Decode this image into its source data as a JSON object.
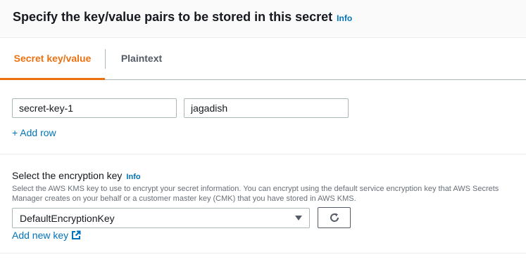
{
  "header": {
    "title": "Specify the key/value pairs to be stored in this secret",
    "info_label": "Info"
  },
  "tabs": [
    {
      "label": "Secret key/value",
      "active": true
    },
    {
      "label": "Plaintext",
      "active": false
    }
  ],
  "key_value": {
    "rows": [
      {
        "key": "secret-key-1",
        "value": "jagadish"
      }
    ],
    "add_row_label": "+ Add row"
  },
  "encryption": {
    "label": "Select the encryption key",
    "info_label": "Info",
    "description": "Select the AWS KMS key to use to encrypt your secret information. You can encrypt using the default service encryption key that AWS Secrets Manager creates on your behalf or a customer master key (CMK) that you have stored in AWS KMS.",
    "selected_key": "DefaultEncryptionKey",
    "add_key_label": "Add new key"
  },
  "icons": {
    "refresh": "refresh-icon",
    "external_link": "external-link-icon",
    "dropdown": "caret-down-icon"
  },
  "colors": {
    "accent": "#ec7211",
    "link": "#0073bb",
    "text": "#16191f",
    "muted": "#687078"
  }
}
